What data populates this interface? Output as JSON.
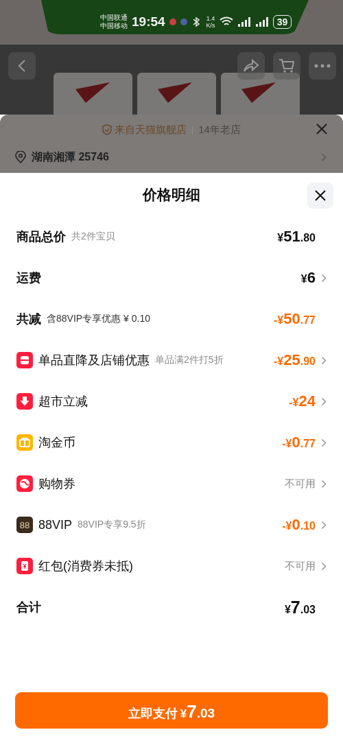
{
  "status_bar": {
    "carriers": [
      "中国联通",
      "中国移动"
    ],
    "time": "19:54",
    "speed_value": "1.4",
    "speed_unit": "K/s",
    "battery": "39"
  },
  "store_banner": {
    "source": "来自天猫旗舰店",
    "age": "14年老店"
  },
  "address": "湖南湘潭 25746",
  "sheet": {
    "title": "价格明细",
    "rows": [
      {
        "kind": "summary",
        "label": "商品总价",
        "note": "共2件宝贝",
        "amount": "¥51.80",
        "discount": false,
        "chevron": false
      },
      {
        "kind": "summary",
        "label": "运费",
        "amount": "¥6",
        "discount": false,
        "chevron": true
      },
      {
        "kind": "summary",
        "label": "共减",
        "note": "含88VIP专享优惠 ¥ 0.10",
        "amount": "-¥50.77",
        "discount": true,
        "chevron": false
      },
      {
        "kind": "item",
        "label": "单品直降及店铺优惠",
        "note": "单品满2件打5折",
        "amount": "-¥25.90",
        "discount": true,
        "chevron": true
      },
      {
        "kind": "item",
        "label": "超市立减",
        "amount": "-¥24",
        "discount": true,
        "chevron": true
      },
      {
        "kind": "item",
        "label": "淘金币",
        "amount": "-¥0.77",
        "discount": true,
        "chevron": true
      },
      {
        "kind": "item",
        "label": "购物券",
        "amount": "不可用",
        "discount": false,
        "chevron": true
      },
      {
        "kind": "item",
        "badge": "88",
        "label": "88VIP",
        "note": "88VIP专享9.5折",
        "amount": "-¥0.10",
        "discount": true,
        "chevron": true
      },
      {
        "kind": "item",
        "label": "红包(消费券未抵)",
        "amount": "不可用",
        "discount": false,
        "chevron": true
      },
      {
        "kind": "total",
        "label": "合计",
        "amount": "¥7.03",
        "discount": false,
        "chevron": false
      }
    ],
    "pay_button": {
      "label": "立即支付",
      "amount": "¥7.03"
    }
  }
}
